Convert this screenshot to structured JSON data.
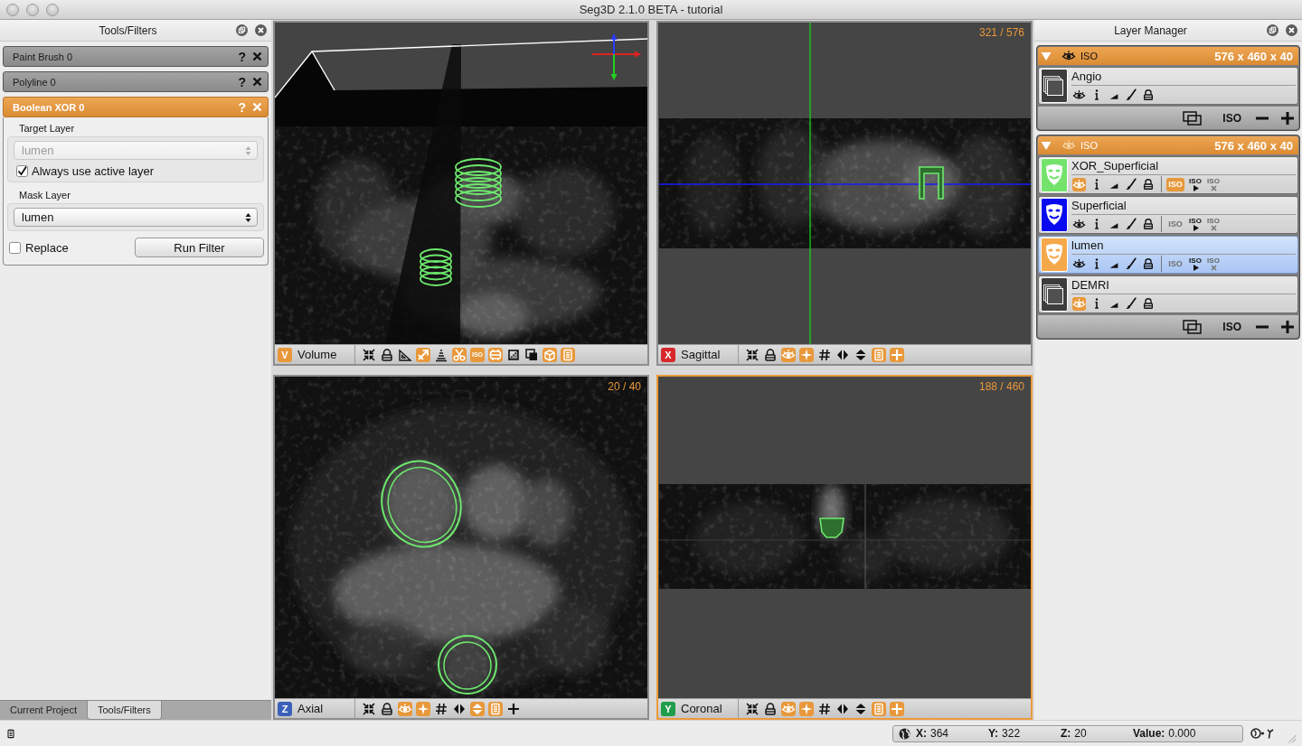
{
  "window": {
    "title": "Seg3D 2.1.0 BETA - tutorial"
  },
  "tools_panel": {
    "title": "Tools/Filters",
    "tools": [
      {
        "title": "Paint Brush 0",
        "help": "?",
        "selected": false
      },
      {
        "title": "Polyline 0",
        "help": "?",
        "selected": false
      },
      {
        "title": "Boolean XOR 0",
        "help": "?",
        "selected": true,
        "target_layer": {
          "label": "Target Layer",
          "value": "lumen",
          "disabled": true
        },
        "always_use_active": {
          "label": "Always use active layer",
          "checked": true
        },
        "mask_layer": {
          "label": "Mask Layer",
          "value": "lumen",
          "disabled": false
        },
        "replace": {
          "label": "Replace",
          "checked": false
        },
        "run_button": "Run Filter"
      }
    ],
    "tabs": [
      {
        "label": "Current Project",
        "selected": false
      },
      {
        "label": "Tools/Filters",
        "selected": true
      }
    ]
  },
  "view_rows": [
    {
      "views": [
        {
          "kind": "volume",
          "badge": "V",
          "color": "#e8983a",
          "label": "Volume",
          "selected": false,
          "tools": [
            {
              "kind": "collapse",
              "on": false
            },
            {
              "kind": "lock",
              "on": false
            },
            {
              "kind": "ruler",
              "on": false
            },
            {
              "kind": "plane",
              "on": true
            },
            {
              "kind": "stack",
              "on": false
            },
            {
              "kind": "scissors",
              "on": true
            },
            {
              "kind": "iso",
              "label": "ISO",
              "on": true
            },
            {
              "kind": "frame",
              "on": true
            },
            {
              "kind": "crop",
              "on": false
            },
            {
              "kind": "copy",
              "on": false
            },
            {
              "kind": "cube",
              "on": true
            },
            {
              "kind": "doc",
              "on": true
            }
          ]
        },
        {
          "kind": "sagittal",
          "badge": "X",
          "color": "#d6282b",
          "label": "Sagittal",
          "slice": "321 / 576",
          "selected": false,
          "tools": [
            {
              "kind": "collapse",
              "on": false
            },
            {
              "kind": "lock",
              "on": false
            },
            {
              "kind": "eye",
              "on": true
            },
            {
              "kind": "sparkle",
              "on": true
            },
            {
              "kind": "grid",
              "on": false
            },
            {
              "kind": "fliph",
              "on": false
            },
            {
              "kind": "flipv",
              "on": false
            },
            {
              "kind": "doc",
              "on": true
            },
            {
              "kind": "plus",
              "on": true
            }
          ]
        }
      ]
    },
    {
      "views": [
        {
          "kind": "axial",
          "badge": "Z",
          "color": "#3b60b8",
          "label": "Axial",
          "slice": "20 / 40",
          "selected": false,
          "tools": [
            {
              "kind": "collapse",
              "on": false
            },
            {
              "kind": "lock",
              "on": false
            },
            {
              "kind": "eye",
              "on": true
            },
            {
              "kind": "sparkle",
              "on": true
            },
            {
              "kind": "grid",
              "on": false
            },
            {
              "kind": "fliph",
              "on": false
            },
            {
              "kind": "flipv",
              "on": true
            },
            {
              "kind": "doc",
              "on": true
            },
            {
              "kind": "plus",
              "on": false
            }
          ]
        },
        {
          "kind": "coronal",
          "badge": "Y",
          "color": "#1f9d4a",
          "label": "Coronal",
          "slice": "188 / 460",
          "selected": true,
          "tools": [
            {
              "kind": "collapse",
              "on": false
            },
            {
              "kind": "lock",
              "on": false
            },
            {
              "kind": "eye",
              "on": true
            },
            {
              "kind": "sparkle",
              "on": true
            },
            {
              "kind": "grid",
              "on": false
            },
            {
              "kind": "fliph",
              "on": false
            },
            {
              "kind": "flipv",
              "on": false
            },
            {
              "kind": "doc",
              "on": true
            },
            {
              "kind": "plus",
              "on": true
            }
          ]
        }
      ]
    }
  ],
  "layer_manager": {
    "title": "Layer Manager",
    "groups": [
      {
        "expanded": true,
        "visible": true,
        "iso": "ISO",
        "size": "576 x 460 x 40",
        "layers": [
          {
            "name": "Angio",
            "kind": "data",
            "selected": false,
            "eye_on": false
          }
        ],
        "footer_iso": "ISO"
      },
      {
        "expanded": true,
        "visible": false,
        "iso": "ISO",
        "size": "576 x 460 x 40",
        "layers": [
          {
            "name": "XOR_Superficial",
            "kind": "mask",
            "color": "#74e36c",
            "selected": false,
            "eye_on": true,
            "iso": {
              "label": "ISO",
              "on": true
            },
            "iso_run": "ISO",
            "iso_clear": {
              "label": "ISO",
              "disabled": true
            }
          },
          {
            "name": "Superficial",
            "kind": "mask",
            "color": "#0a0af0",
            "selected": false,
            "eye_on": false,
            "iso": {
              "label": "ISO",
              "on": false
            },
            "iso_run": "ISO",
            "iso_clear": {
              "label": "ISO",
              "disabled": true
            }
          },
          {
            "name": "lumen",
            "kind": "mask",
            "color": "#f5a84a",
            "selected": true,
            "eye_on": false,
            "iso": {
              "label": "ISO",
              "on": false
            },
            "iso_run": "ISO",
            "iso_clear": {
              "label": "ISO",
              "disabled": true
            }
          },
          {
            "name": "DEMRI",
            "kind": "data",
            "selected": false,
            "eye_on": true
          }
        ],
        "footer_iso": "ISO"
      }
    ]
  },
  "status_bar": {
    "coords": [
      {
        "label": "X:",
        "value": "364"
      },
      {
        "label": "Y:",
        "value": "322"
      },
      {
        "label": "Z:",
        "value": "20"
      },
      {
        "label": "Value:",
        "value": "0.000"
      }
    ]
  }
}
